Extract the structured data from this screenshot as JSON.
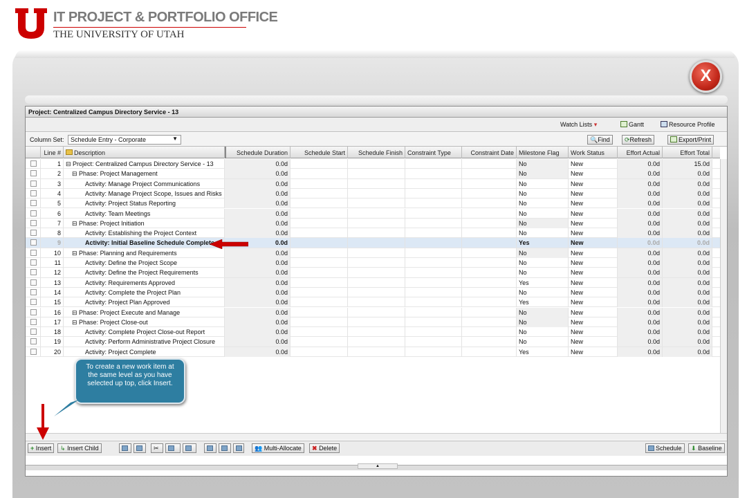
{
  "header": {
    "org_title": "IT PROJECT & PORTFOLIO OFFICE",
    "org_subtitle": "THE UNIVERSITY OF UTAH"
  },
  "close_button": "X",
  "app": {
    "project_title": "Project: Centralized Campus Directory Service - 13",
    "toolbar": {
      "watch_lists": "Watch Lists",
      "gantt": "Gantt",
      "resource_profile": "Resource Profile"
    },
    "column_set_label": "Column Set:",
    "column_set_value": "Schedule Entry - Corporate",
    "find": "Find",
    "refresh": "Refresh",
    "export_print": "Export/Print",
    "columns": [
      "Line #",
      "Description",
      "Schedule Duration",
      "Schedule Start",
      "Schedule Finish",
      "Constraint Type",
      "Constraint Date",
      "Milestone Flag",
      "Work Status",
      "Effort Actual",
      "Effort Total"
    ],
    "rows": [
      {
        "line": "1",
        "desc": "Project: Centralized Campus Directory Service - 13",
        "dur": "0.0d",
        "ms": "No",
        "ws": "New",
        "ea": "0.0d",
        "et": "15.0d"
      },
      {
        "line": "2",
        "desc": "Phase: Project Management",
        "dur": "0.0d",
        "ms": "No",
        "ws": "New",
        "ea": "0.0d",
        "et": "0.0d"
      },
      {
        "line": "3",
        "desc": "Activity: Manage Project Communications",
        "dur": "0.0d",
        "ms": "No",
        "ws": "New",
        "ea": "0.0d",
        "et": "0.0d"
      },
      {
        "line": "4",
        "desc": "Activity: Manage Project Scope, Issues and Risks",
        "dur": "0.0d",
        "ms": "No",
        "ws": "New",
        "ea": "0.0d",
        "et": "0.0d"
      },
      {
        "line": "5",
        "desc": "Activity: Project Status Reporting",
        "dur": "0.0d",
        "ms": "No",
        "ws": "New",
        "ea": "0.0d",
        "et": "0.0d"
      },
      {
        "line": "6",
        "desc": "Activity: Team Meetings",
        "dur": "0.0d",
        "ms": "No",
        "ws": "New",
        "ea": "0.0d",
        "et": "0.0d"
      },
      {
        "line": "7",
        "desc": "Phase: Project Initiation",
        "dur": "0.0d",
        "ms": "No",
        "ws": "New",
        "ea": "0.0d",
        "et": "0.0d"
      },
      {
        "line": "8",
        "desc": "Activity: Establishing the Project Context",
        "dur": "0.0d",
        "ms": "No",
        "ws": "New",
        "ea": "0.0d",
        "et": "0.0d"
      },
      {
        "line": "9",
        "desc": "Activity: Initial Baseline Schedule Complete",
        "dur": "0.0d",
        "ms": "Yes",
        "ws": "New",
        "ea": "0.0d",
        "et": "0.0d"
      },
      {
        "line": "10",
        "desc": "Phase: Planning and Requirements",
        "dur": "0.0d",
        "ms": "No",
        "ws": "New",
        "ea": "0.0d",
        "et": "0.0d"
      },
      {
        "line": "11",
        "desc": "Activity: Define the Project Scope",
        "dur": "0.0d",
        "ms": "No",
        "ws": "New",
        "ea": "0.0d",
        "et": "0.0d"
      },
      {
        "line": "12",
        "desc": "Activity: Define the Project Requirements",
        "dur": "0.0d",
        "ms": "No",
        "ws": "New",
        "ea": "0.0d",
        "et": "0.0d"
      },
      {
        "line": "13",
        "desc": "Activity: Requirements Approved",
        "dur": "0.0d",
        "ms": "Yes",
        "ws": "New",
        "ea": "0.0d",
        "et": "0.0d"
      },
      {
        "line": "14",
        "desc": "Activity: Complete the Project Plan",
        "dur": "0.0d",
        "ms": "No",
        "ws": "New",
        "ea": "0.0d",
        "et": "0.0d"
      },
      {
        "line": "15",
        "desc": "Activity: Project Plan Approved",
        "dur": "0.0d",
        "ms": "Yes",
        "ws": "New",
        "ea": "0.0d",
        "et": "0.0d"
      },
      {
        "line": "16",
        "desc": "Phase: Project Execute and Manage",
        "dur": "0.0d",
        "ms": "No",
        "ws": "New",
        "ea": "0.0d",
        "et": "0.0d"
      },
      {
        "line": "17",
        "desc": "Phase: Project Close-out",
        "dur": "0.0d",
        "ms": "No",
        "ws": "New",
        "ea": "0.0d",
        "et": "0.0d"
      },
      {
        "line": "18",
        "desc": "Activity: Complete Project Close-out Report",
        "dur": "0.0d",
        "ms": "No",
        "ws": "New",
        "ea": "0.0d",
        "et": "0.0d"
      },
      {
        "line": "19",
        "desc": "Activity: Perform Administrative Project Closure",
        "dur": "0.0d",
        "ms": "No",
        "ws": "New",
        "ea": "0.0d",
        "et": "0.0d"
      },
      {
        "line": "20",
        "desc": "Activity: Project Complete",
        "dur": "0.0d",
        "ms": "Yes",
        "ws": "New",
        "ea": "0.0d",
        "et": "0.0d"
      }
    ],
    "bottom": {
      "insert": "Insert",
      "insert_child": "Insert Child",
      "multi_allocate": "Multi-Allocate",
      "delete": "Delete",
      "schedule": "Schedule",
      "baseline": "Baseline"
    }
  },
  "tooltip": "To create a new work item at the same level as you have selected up top, click Insert."
}
